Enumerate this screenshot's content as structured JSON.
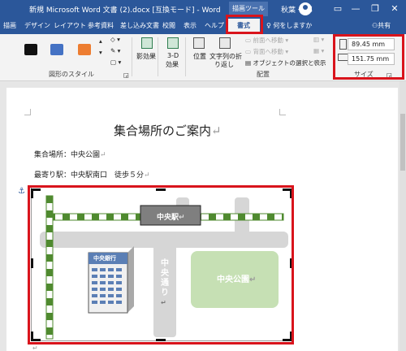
{
  "window": {
    "title": "新規 Microsoft Word 文書 (2).docx [互換モード]  -  Word",
    "tools_tab": "描画ツール",
    "user": "秋葉 一郎",
    "minimize": "—",
    "restore": "❐",
    "close": "✕"
  },
  "tabs": [
    {
      "label": "描画"
    },
    {
      "label": "デザイン"
    },
    {
      "label": "レイアウト"
    },
    {
      "label": "参考資料"
    },
    {
      "label": "差し込み文書"
    },
    {
      "label": "校閲"
    },
    {
      "label": "表示"
    },
    {
      "label": "ヘルプ"
    },
    {
      "label": "書式"
    }
  ],
  "help_search": "何をしますか",
  "share": "共有",
  "ribbon": {
    "styles_group": "図形のスタイル",
    "style_colors": [
      "#111111",
      "#4472c4",
      "#ed7d31"
    ],
    "shadow_effects": "影効果",
    "effects_3d_line1": "3-D",
    "effects_3d_line2": "効果",
    "position": "位置",
    "wrap_line1": "文字列の折",
    "wrap_line2": "り返し",
    "bring_forward": "前面へ移動",
    "send_backward": "背面へ移動",
    "selection_pane": "オブジェクトの選択と表示",
    "arrange_group": "配置",
    "size_group": "サイズ",
    "height": "89.45 mm",
    "width": "151.75 mm"
  },
  "document": {
    "title": "集合場所のご案内",
    "line1": "集合場所：中央公園",
    "line2": "最寄り駅：中央駅南口　徒歩５分",
    "para_mark": "↵"
  },
  "map": {
    "station": "中央駅",
    "bank": "中央銀行",
    "street": "中央通り",
    "park": "中央公園",
    "colors": {
      "rail": "#4f8a2f",
      "road": "#d6d6d6",
      "park": "#c6e0b4",
      "building": "#5b7fb5"
    }
  }
}
